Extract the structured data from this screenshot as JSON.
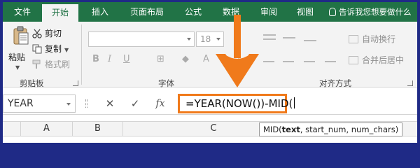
{
  "ribbon_tabs": [
    "文件",
    "开始",
    "插入",
    "页面布局",
    "公式",
    "数据",
    "审阅",
    "视图"
  ],
  "tell_me": "告诉我您想要做什么",
  "clipboard": {
    "paste": "粘贴",
    "cut": "剪切",
    "copy": "复制",
    "format_painter": "格式刷",
    "group_label": "剪贴板"
  },
  "font": {
    "font_name": "",
    "font_size": "18",
    "group_label": "字体"
  },
  "alignment": {
    "wrap_text": "自动换行",
    "merge_center": "合并后居中",
    "group_label": "对齐方式"
  },
  "formula_bar": {
    "name_box": "YEAR",
    "cancel_symbol": "✕",
    "enter_symbol": "✓",
    "fx_symbol": "fx",
    "formula": "=YEAR(NOW())-MID("
  },
  "columns": [
    "A",
    "B",
    "C"
  ],
  "tooltip": {
    "function": "MID(",
    "arg_current": "text",
    "arg_rest": ", start_num, num_chars)"
  },
  "colors": {
    "ribbon_green": "#217346",
    "highlight_orange": "#f07a1b",
    "frame_blue": "#1f2a86"
  },
  "icons": [
    "paste-icon",
    "scissors-icon",
    "copy-icon",
    "format-painter-icon",
    "wrap-text-icon",
    "merge-center-icon",
    "lightbulb-icon"
  ]
}
